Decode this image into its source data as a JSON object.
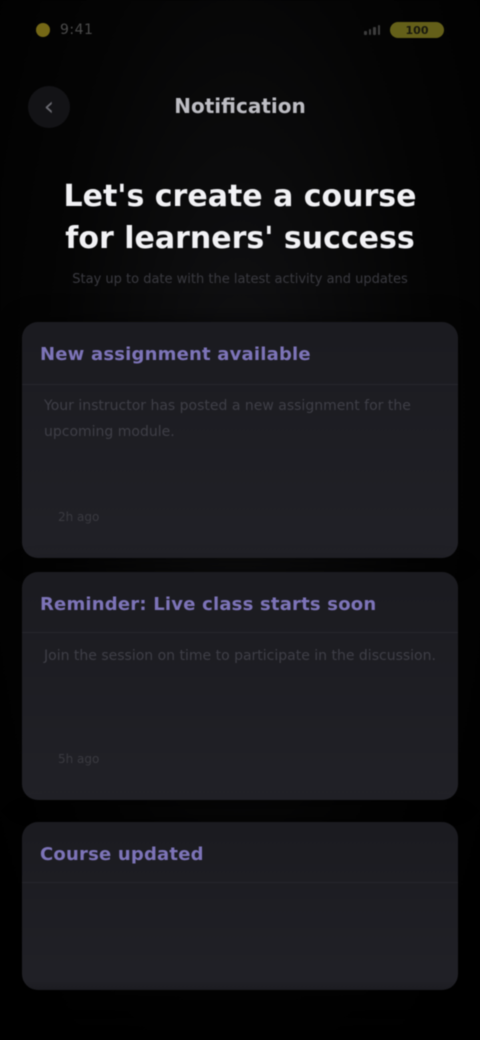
{
  "status_bar": {
    "time": "9:41",
    "battery_label": "100",
    "accent_color": "#8a7a1a"
  },
  "nav": {
    "back_icon": "chevron-left-icon",
    "back_glyph": "‹",
    "title": "Notification"
  },
  "hero": {
    "title": "Let's create a course for learners' success",
    "subtitle": "Stay up to date with the latest activity and updates"
  },
  "cards": [
    {
      "header": "New assignment available",
      "body": "Your instructor has posted a new assignment for the upcoming module.",
      "meta": "2h ago"
    },
    {
      "header": "Reminder: Live class starts soon",
      "body": "Join the session on time to participate in the discussion.",
      "meta": "5h ago"
    },
    {
      "header": "Course updated",
      "body": "",
      "meta": ""
    }
  ],
  "colors": {
    "card_header": "#7d74b8",
    "card_bg": "#1e1e23",
    "background": "#000000"
  }
}
